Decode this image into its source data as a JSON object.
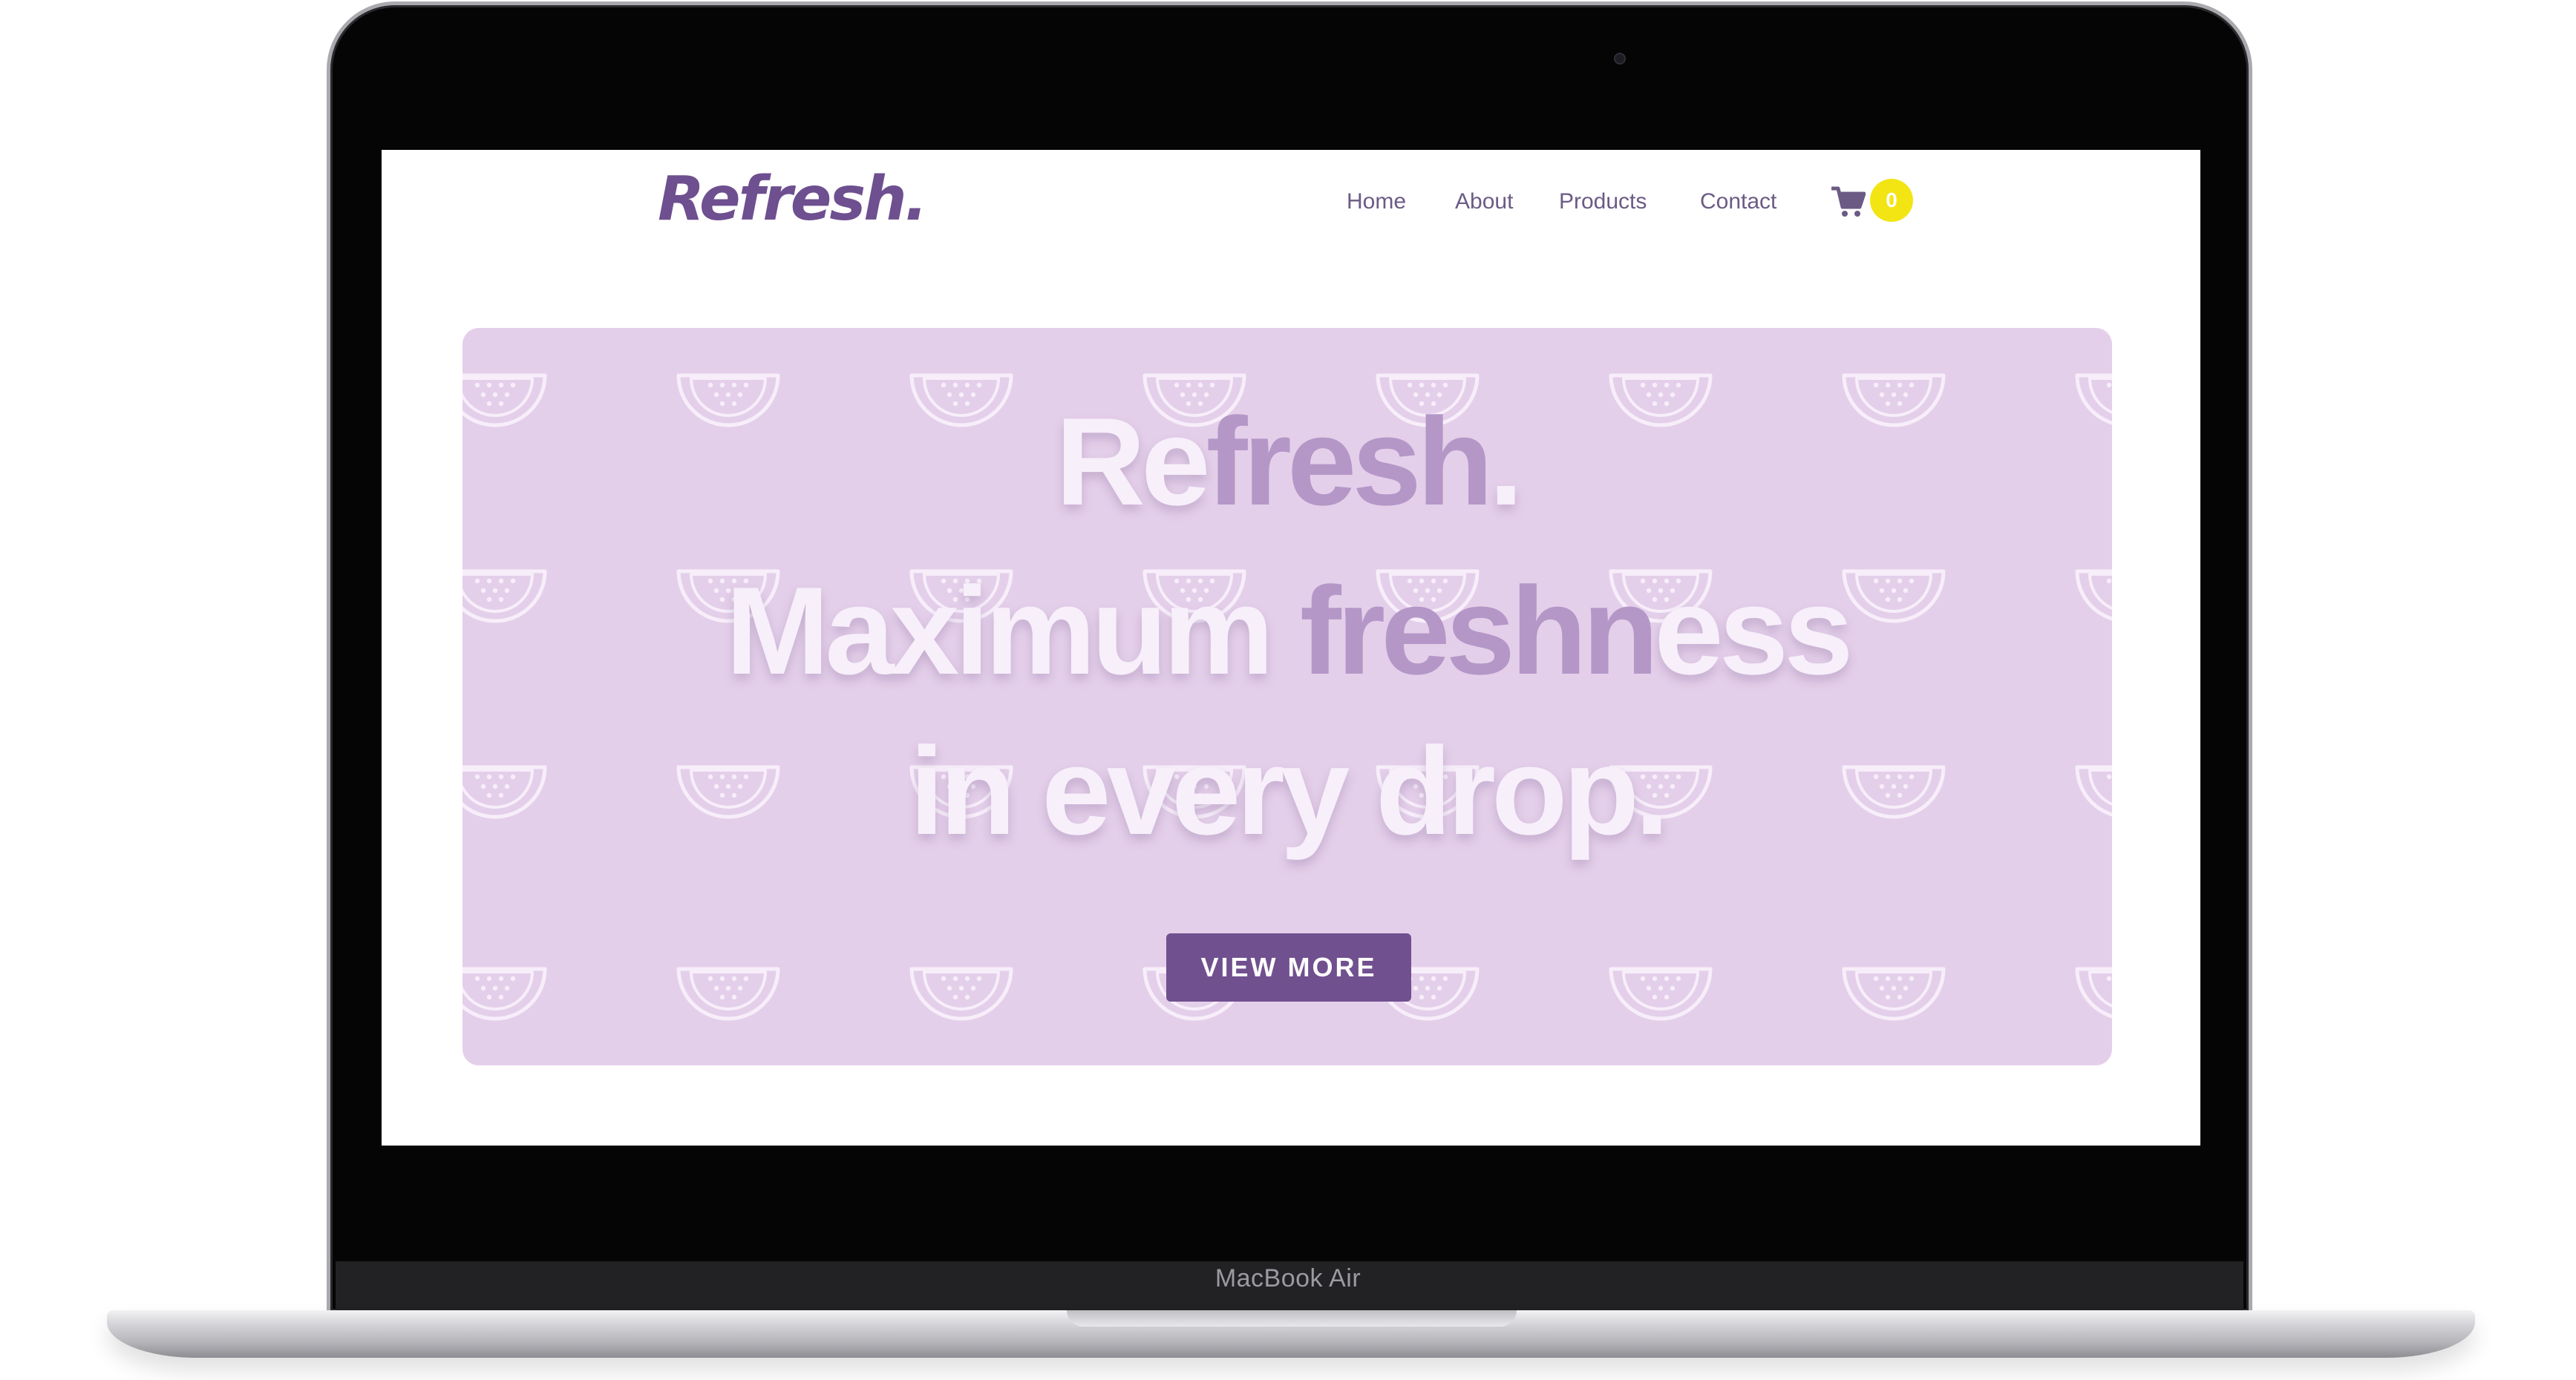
{
  "device": {
    "label": "MacBook Air"
  },
  "header": {
    "logo_text": "Refresh.",
    "nav": [
      {
        "label": "Home"
      },
      {
        "label": "About"
      },
      {
        "label": "Products"
      },
      {
        "label": "Contact"
      }
    ],
    "cart": {
      "icon": "cart-icon",
      "count": "0"
    }
  },
  "hero": {
    "line1": {
      "a": "Re",
      "b": "fresh",
      "c": "."
    },
    "line2": {
      "a": "Maximum ",
      "b": "freshn",
      "c": "ess"
    },
    "line3": "in every drop.",
    "button_label": "VIEW MORE",
    "pattern_icon": "watermelon-icon"
  },
  "colors": {
    "brand": "#6e4f8f",
    "hero_bg": "#e4cfea",
    "badge": "#f2e513",
    "button": "#70508f"
  }
}
